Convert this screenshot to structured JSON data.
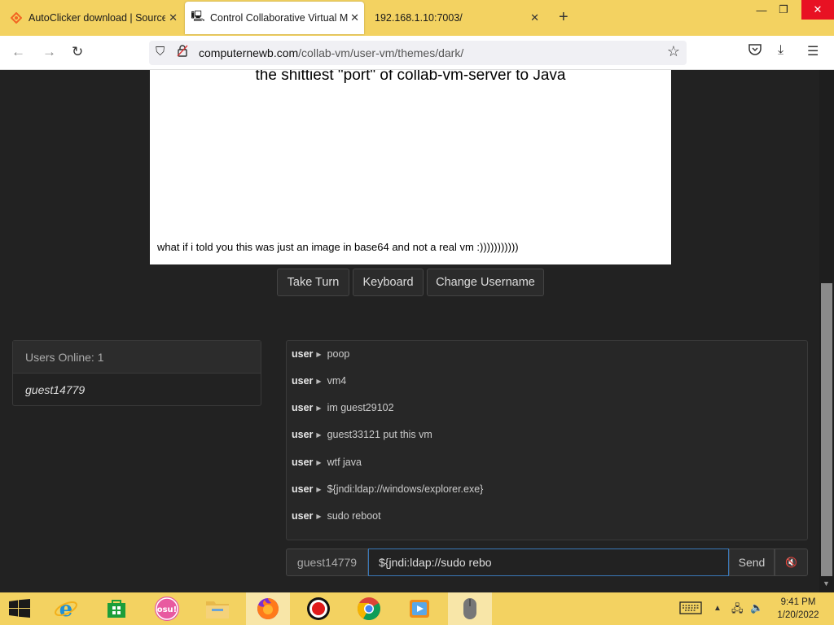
{
  "browser": {
    "tabs": [
      {
        "title": "AutoClicker download | SourceF"
      },
      {
        "title": "Control Collaborative Virtual M"
      },
      {
        "title": "192.168.1.10:7003/"
      }
    ],
    "url_domain": "computernewb.com",
    "url_path": "/collab-vm/user-vm/themes/dark/"
  },
  "vm": {
    "headline": "the shittiest \"port\" of collab-vm-server to Java",
    "footline": "what if i told you this was just an image in base64 and not a real vm :)))))))))))"
  },
  "controls": {
    "take_turn": "Take Turn",
    "keyboard": "Keyboard",
    "change_username": "Change Username"
  },
  "users": {
    "header": "Users Online: 1",
    "list": [
      "guest14779"
    ]
  },
  "chat": {
    "messages": [
      {
        "user": "user",
        "text": "poop"
      },
      {
        "user": "user",
        "text": "vm4"
      },
      {
        "user": "user",
        "text": "im guest29102"
      },
      {
        "user": "user",
        "text": "guest33121 put this vm"
      },
      {
        "user": "user",
        "text": "wtf java"
      },
      {
        "user": "user",
        "text": "${jndi:ldap://windows/explorer.exe}"
      },
      {
        "user": "user",
        "text": "sudo reboot"
      }
    ],
    "username": "guest14779",
    "input_value": "${jndi:ldap://sudo rebo",
    "send_label": "Send"
  },
  "taskbar": {
    "time": "9:41 PM",
    "date": "1/20/2022"
  },
  "colors": {
    "chrome_accent": "#f3d261",
    "page_bg": "#222222",
    "input_focus": "#3a78b8"
  }
}
